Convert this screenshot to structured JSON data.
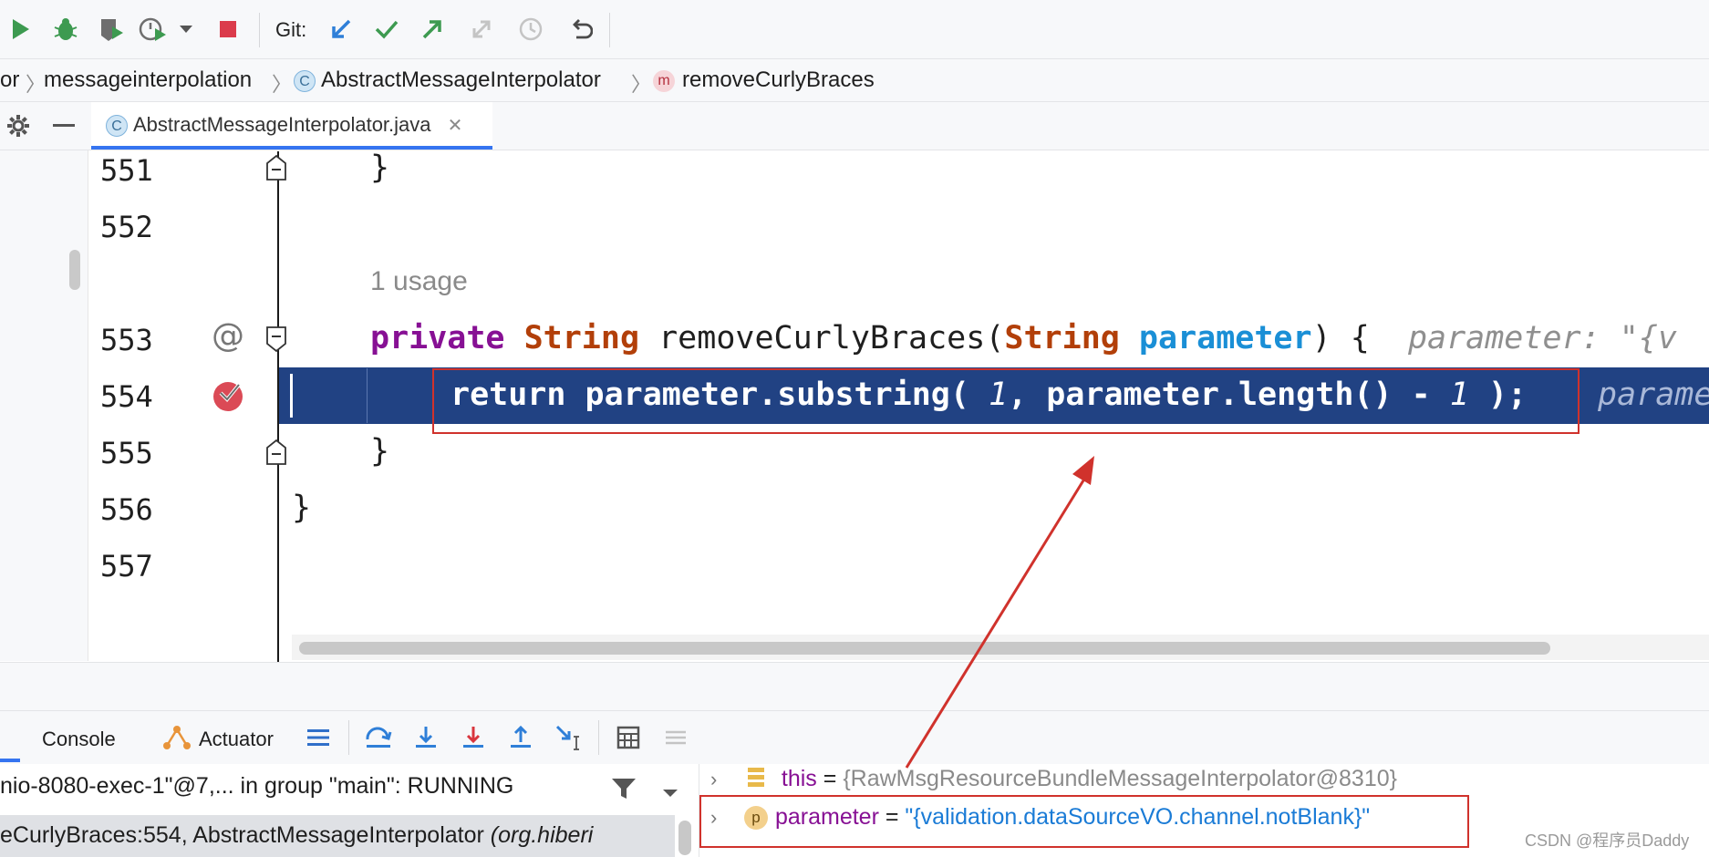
{
  "toolbar": {
    "git_label": "Git:"
  },
  "breadcrumb": [
    {
      "label": "or",
      "kind": "package"
    },
    {
      "label": "messageinterpolation",
      "kind": "package"
    },
    {
      "label": "AbstractMessageInterpolator",
      "kind": "class",
      "badge": "C"
    },
    {
      "label": "removeCurlyBraces",
      "kind": "method",
      "badge": "m"
    }
  ],
  "tab": {
    "badge": "C",
    "label": "AbstractMessageInterpolator.java",
    "close": "✕"
  },
  "editor": {
    "lines": [
      {
        "number": "551",
        "code": "}"
      },
      {
        "number": "552",
        "code": ""
      },
      {
        "usage_hint": "1 usage"
      },
      {
        "number": "553",
        "marker": "@",
        "kw": "private",
        "type": "String",
        "name": "removeCurlyBraces(",
        "type2": "String",
        "param": "parameter",
        "rest": ") {",
        "hint": "parameter: \"{v"
      },
      {
        "number": "554",
        "kw": "return",
        "code": "parameter.substring( ",
        "num1": "1",
        "mid": ", parameter.length() - ",
        "num2": "1",
        "end": " );",
        "hint": "parame"
      },
      {
        "number": "555",
        "code": "}"
      },
      {
        "number": "556",
        "code": "}"
      },
      {
        "number": "557",
        "code": ""
      }
    ]
  },
  "debug": {
    "console_tab": "Console",
    "actuator_tab": "Actuator",
    "thread": "nio-8080-exec-1\"@7,... in group \"main\": RUNNING",
    "frame_method": "eCurlyBraces:554, AbstractMessageInterpolator ",
    "frame_pkg": "(org.hiberi",
    "variables": [
      {
        "name": "this",
        "eq": " = ",
        "value": "{RawMsgResourceBundleMessageInterpolator@8310}"
      },
      {
        "badge": "p",
        "name": "parameter",
        "eq": " = ",
        "value": "\"{validation.dataSourceVO.channel.notBlank}\""
      }
    ]
  },
  "watermark": "CSDN @程序员Daddy",
  "colors": {
    "exec_line": "#214283",
    "annotation_red": "#d0322c",
    "keyword": "#871094",
    "type": "#b23f09",
    "param": "#1a8fd6"
  }
}
